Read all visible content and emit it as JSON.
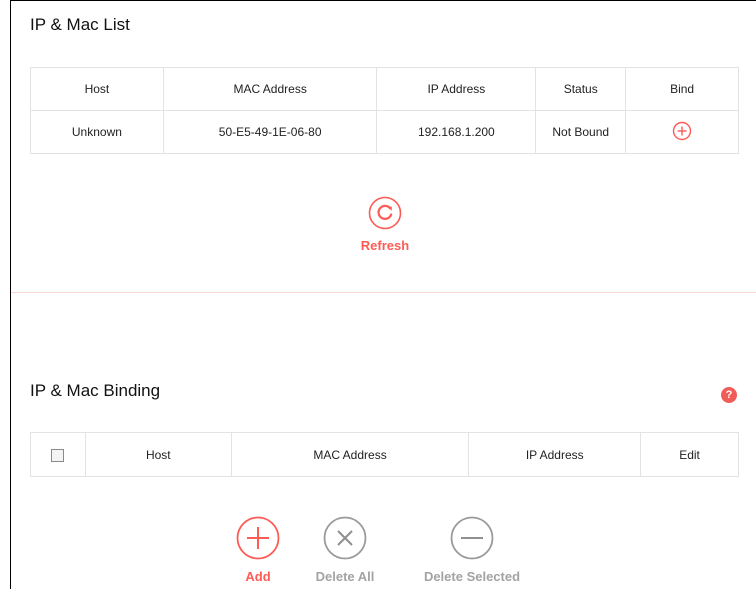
{
  "ip_mac_list": {
    "title": "IP & Mac List",
    "columns": [
      "Host",
      "MAC Address",
      "IP Address",
      "Status",
      "Bind"
    ],
    "rows": [
      {
        "host": "Unknown",
        "mac": "50-E5-49-1E-06-80",
        "ip": "192.168.1.200",
        "status": "Not Bound",
        "bind_icon": "add-circle-icon"
      }
    ],
    "refresh": {
      "label": "Refresh",
      "icon": "refresh-icon"
    }
  },
  "ip_mac_binding": {
    "title": "IP & Mac Binding",
    "help_icon": "?",
    "columns": [
      "Host",
      "MAC Address",
      "IP Address",
      "Edit"
    ],
    "actions": {
      "add": "Add",
      "delete_all": "Delete All",
      "delete_selected": "Delete Selected"
    }
  },
  "colors": {
    "accent": "#ff5b55",
    "disabled": "#a3a3a3",
    "divider": "#f6d6d4",
    "border": "#e3e3e3"
  }
}
